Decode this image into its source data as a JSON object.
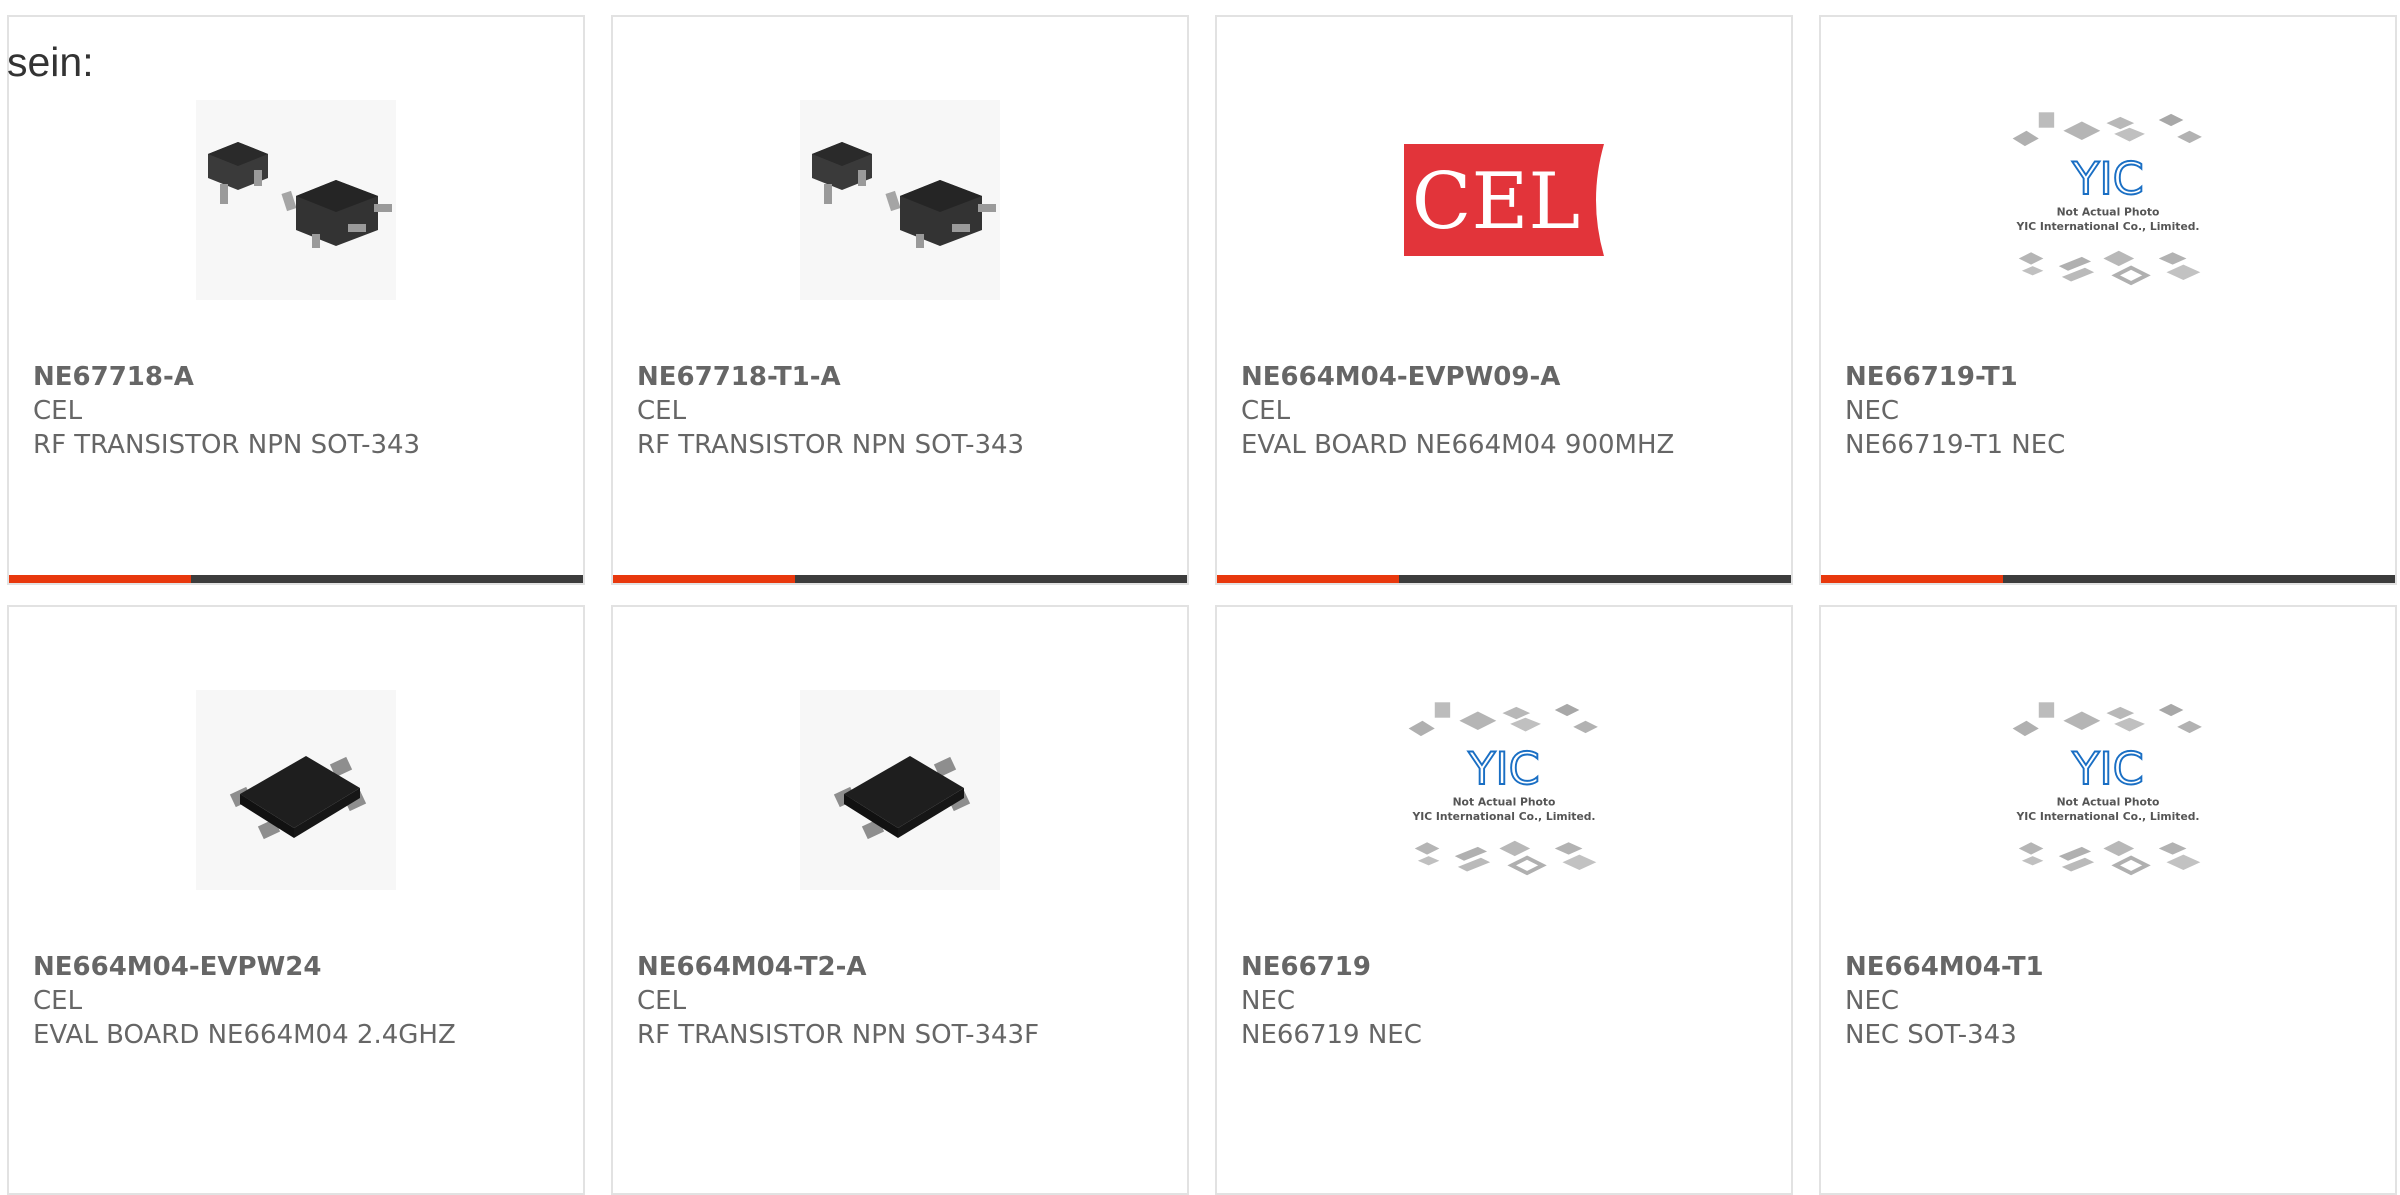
{
  "lead_text": "sein:",
  "products": [
    {
      "part": "NE67718-A",
      "brand": "CEL",
      "desc": "RF TRANSISTOR NPN SOT-343",
      "image_icon": "sot-343-pair-photo"
    },
    {
      "part": "NE67718-T1-A",
      "brand": "CEL",
      "desc": "RF TRANSISTOR NPN SOT-343",
      "image_icon": "sot-343-pair-photo"
    },
    {
      "part": "NE664M04-EVPW09-A",
      "brand": "CEL",
      "desc": "EVAL BOARD NE664M04 900MHZ",
      "image_icon": "cel-logo",
      "logo_text": "CEL"
    },
    {
      "part": "NE66719-T1",
      "brand": "NEC",
      "desc": "NE66719-T1 NEC",
      "image_icon": "yic-placeholder",
      "placeholder_logo": "YIC",
      "placeholder_line1": "Not Actual Photo",
      "placeholder_line2": "YIC International Co., Limited."
    },
    {
      "part": "NE664M04-EVPW24",
      "brand": "CEL",
      "desc": "EVAL BOARD NE664M04 2.4GHZ",
      "image_icon": "sot-343f-photo"
    },
    {
      "part": "NE664M04-T2-A",
      "brand": "CEL",
      "desc": "RF TRANSISTOR NPN SOT-343F",
      "image_icon": "sot-343f-photo"
    },
    {
      "part": "NE66719",
      "brand": "NEC",
      "desc": "NE66719 NEC",
      "image_icon": "yic-placeholder",
      "placeholder_logo": "YIC",
      "placeholder_line1": "Not Actual Photo",
      "placeholder_line2": "YIC International Co., Limited."
    },
    {
      "part": "NE664M04-T1",
      "brand": "NEC",
      "desc": "NEC SOT-343",
      "image_icon": "yic-placeholder",
      "placeholder_logo": "YIC",
      "placeholder_line1": "Not Actual Photo",
      "placeholder_line2": "YIC International Co., Limited."
    }
  ],
  "colors": {
    "accent": "#e8380d",
    "bar_dark": "#3c3c3c",
    "text": "#666666",
    "card_border": "#e2e2e2",
    "cel_logo_red": "#e2343a",
    "yic_blue": "#1a6fc4"
  }
}
